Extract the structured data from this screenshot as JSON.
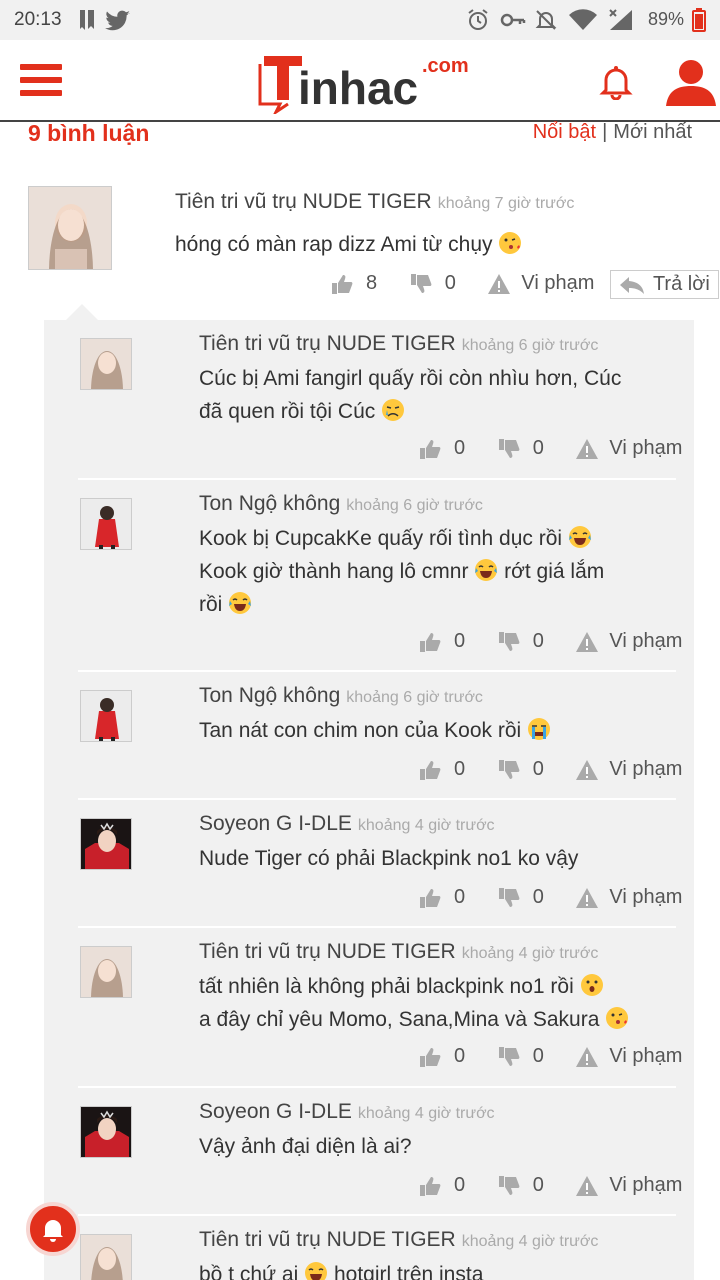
{
  "status_bar": {
    "time": "20:13",
    "battery": "89%"
  },
  "header": {
    "logo_text": "inhac",
    "logo_domain": ".com"
  },
  "comments": {
    "count_label": "9 bình luận",
    "sort_featured": "Nổi bật",
    "sort_newest": "Mới nhất",
    "report_label": "Vi phạm",
    "reply_label": "Trả lời",
    "top": {
      "author": "Tiên tri vũ trụ NUDE TIGER",
      "time": "khoảng 7 giờ trước",
      "text": "hóng có màn rap dizz Ami từ chụy",
      "likes": "8",
      "dislikes": "0"
    },
    "replies": [
      {
        "author": "Tiên tri vũ trụ NUDE TIGER",
        "time": "khoảng 6 giờ trước",
        "lines": [
          "Cúc bị Ami fangirl quấy rồi còn nhìu hơn, Cúc",
          "đã quen rồi tội Cúc"
        ],
        "likes": "0",
        "dislikes": "0"
      },
      {
        "author": "Ton Ngộ không",
        "time": "khoảng 6 giờ trước",
        "lines": [
          "Kook bị CupcakKe quấy rối tình dục rồi",
          "Kook giờ thành hang lô cmnr",
          "rớt giá lắm",
          "rồi"
        ],
        "likes": "0",
        "dislikes": "0"
      },
      {
        "author": "Ton Ngộ không",
        "time": "khoảng 6 giờ trước",
        "lines": [
          "Tan nát con chim non của Kook rồi"
        ],
        "likes": "0",
        "dislikes": "0"
      },
      {
        "author": "Soyeon G I-DLE",
        "time": "khoảng 4 giờ trước",
        "lines": [
          "Nude Tiger có phải Blackpink no1 ko vậy"
        ],
        "likes": "0",
        "dislikes": "0"
      },
      {
        "author": "Tiên tri vũ trụ NUDE TIGER",
        "time": "khoảng 4 giờ trước",
        "lines": [
          "tất nhiên là không phải blackpink no1 rồi",
          "a đây chỉ yêu Momo, Sana,Mina và Sakura"
        ],
        "likes": "0",
        "dislikes": "0"
      },
      {
        "author": "Soyeon G I-DLE",
        "time": "khoảng 4 giờ trước",
        "lines": [
          "Vậy ảnh đại diện là ai?"
        ],
        "likes": "0",
        "dislikes": "0"
      },
      {
        "author": "Tiên tri vũ trụ NUDE TIGER",
        "time": "khoảng 4 giờ trước",
        "lines": [
          "bồ t chứ ai",
          "hotgirl trên insta"
        ],
        "likes": "",
        "dislikes": ""
      }
    ]
  },
  "colors": {
    "brand": "#e2301c",
    "panel": "#f1f1f1"
  }
}
